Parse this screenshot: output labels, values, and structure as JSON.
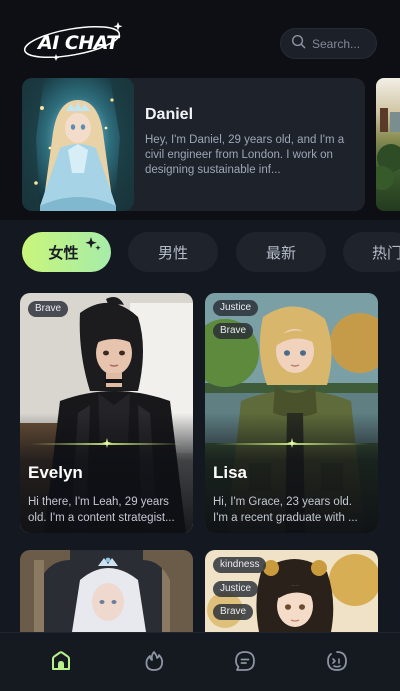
{
  "header": {
    "logo_text": "AI CHAT",
    "search_placeholder": "Search..."
  },
  "featured": {
    "name": "Daniel",
    "description": "Hey, I'm Daniel, 29 years old, and I'm a civil engineer from London. I work on designing sustainable inf..."
  },
  "tabs": [
    "女性",
    "男性",
    "最新",
    "热门"
  ],
  "active_tab": "女性",
  "characters": [
    {
      "name": "Evelyn",
      "tags": [
        "Brave"
      ],
      "description": "Hi there, I'm Leah, 29 years old. I'm a content strategist..."
    },
    {
      "name": "Lisa",
      "tags": [
        "Justice",
        "Brave"
      ],
      "description": "Hi, I'm Grace, 23 years old. I'm a recent graduate with ..."
    },
    {
      "name": "",
      "tags": [],
      "description": ""
    },
    {
      "name": "",
      "tags": [
        "kindness",
        "Justice",
        "Brave"
      ],
      "description": ""
    }
  ],
  "bottom_nav": [
    "home-icon",
    "fire-icon",
    "chat-icon",
    "smile-icon"
  ],
  "colors": {
    "background": "#0d0f14",
    "accent_start": "#c9f57a",
    "accent_end": "#a6ecaa",
    "active_nav": "#b8f08a"
  }
}
